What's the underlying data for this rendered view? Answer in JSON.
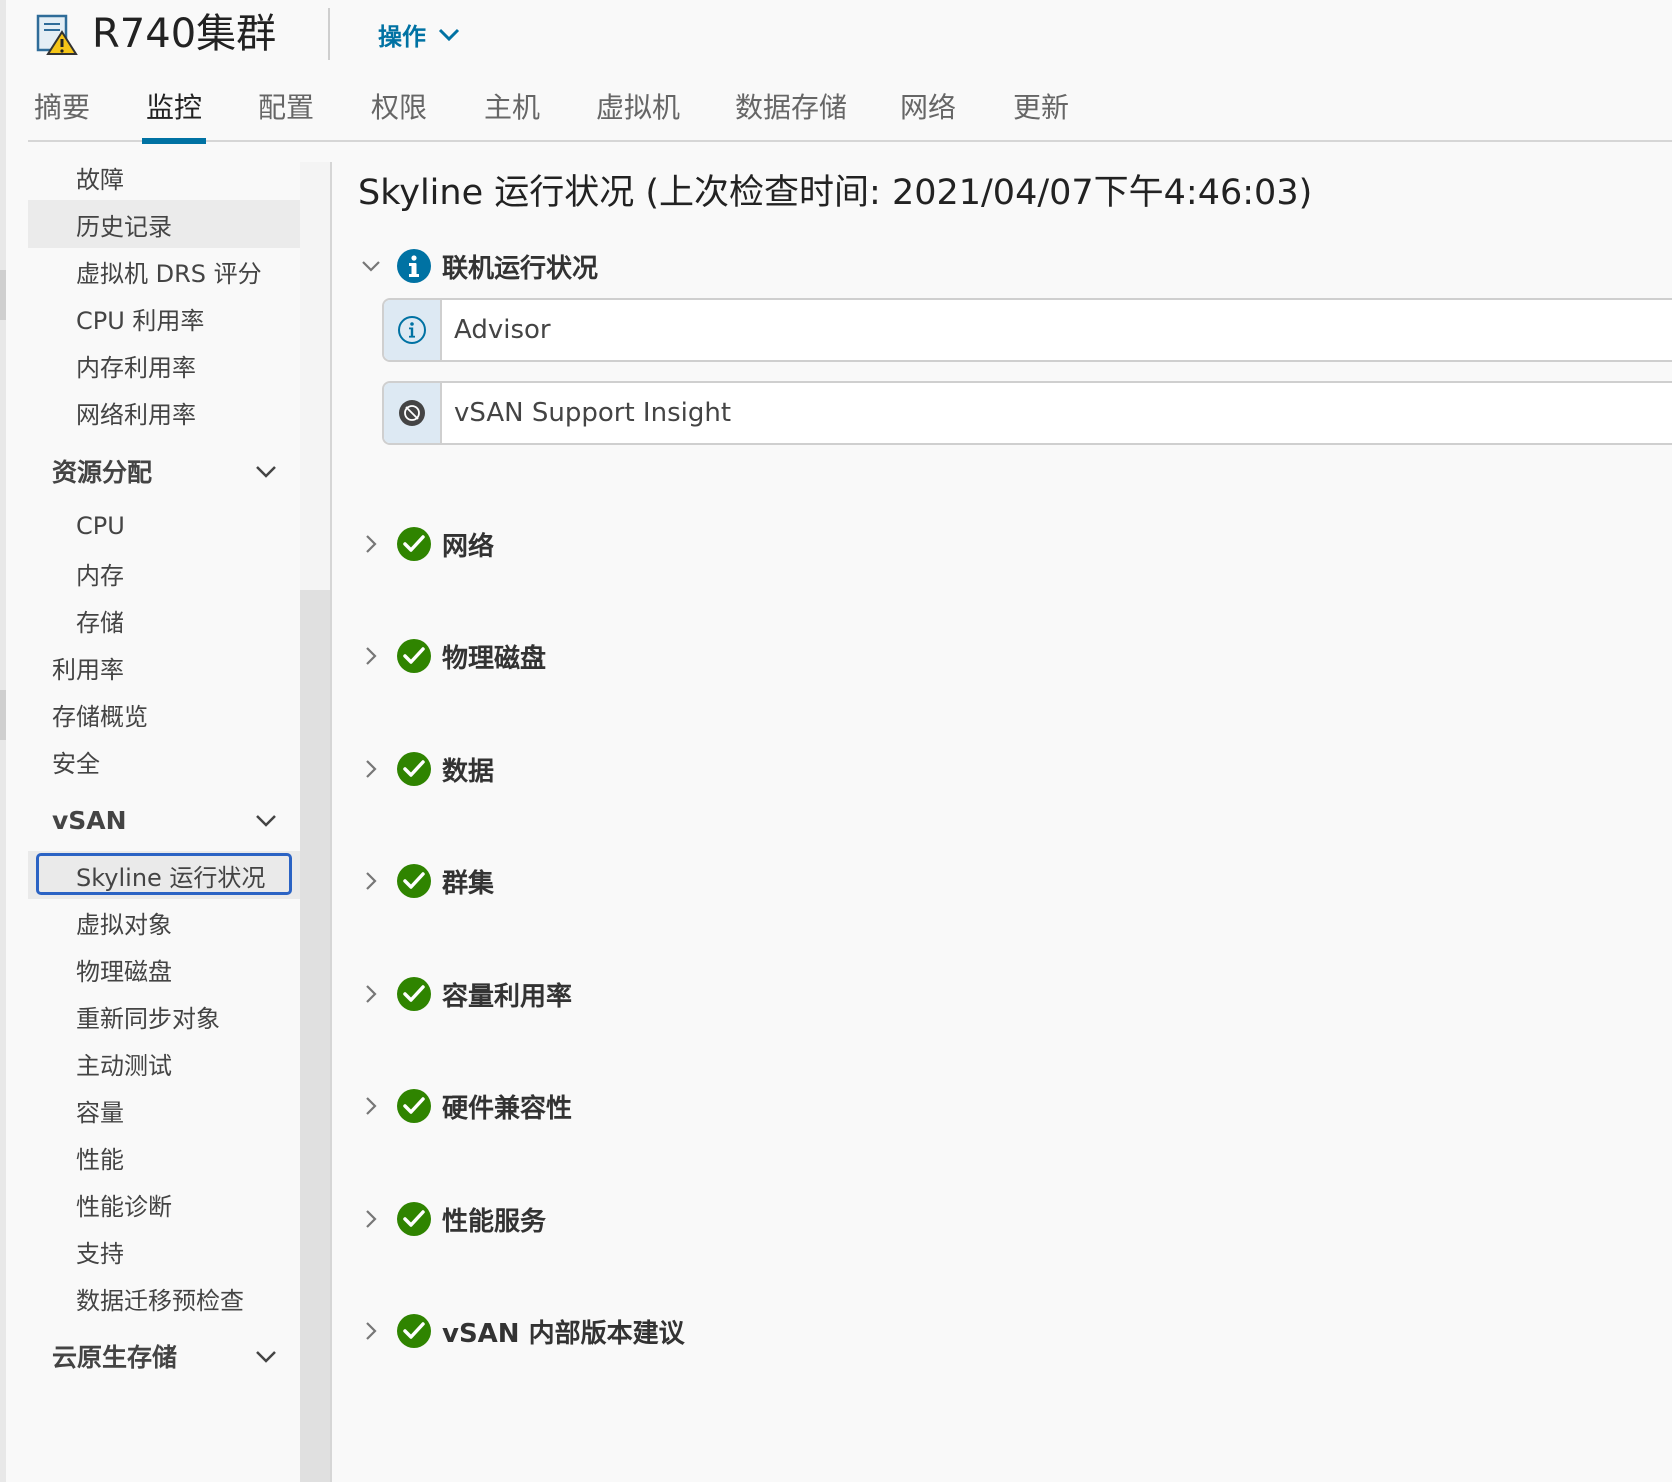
{
  "header": {
    "title": "R740集群",
    "actions_label": "操作"
  },
  "tabs": [
    "摘要",
    "监控",
    "配置",
    "权限",
    "主机",
    "虚拟机",
    "数据存储",
    "网络",
    "更新"
  ],
  "active_tab": "监控",
  "nav": {
    "items_top": [
      "故障",
      "历史记录",
      "虚拟机 DRS 评分",
      "CPU 利用率",
      "内存利用率",
      "网络利用率"
    ],
    "group_resource": "资源分配",
    "resource_items": [
      "CPU",
      "内存",
      "存储"
    ],
    "plain_items": [
      "利用率",
      "存储概览",
      "安全"
    ],
    "group_vsan": "vSAN",
    "vsan_items": [
      "Skyline 运行状况",
      "虚拟对象",
      "物理磁盘",
      "重新同步对象",
      "主动测试",
      "容量",
      "性能",
      "性能诊断",
      "支持",
      "数据迁移预检查"
    ],
    "group_cloud": "云原生存储",
    "selected_item": "Skyline 运行状况"
  },
  "main": {
    "title": "Skyline 运行状况 (上次检查时间: 2021/04/07下午4:46:03)",
    "online_section": {
      "label": "联机运行状况",
      "status": "info",
      "expanded": true,
      "cards": [
        {
          "label": "Advisor",
          "icon": "info-icon"
        },
        {
          "label": "vSAN Support Insight",
          "icon": "disabled-icon"
        }
      ]
    },
    "sections": [
      {
        "label": "网络",
        "status": "ok"
      },
      {
        "label": "物理磁盘",
        "status": "ok"
      },
      {
        "label": "数据",
        "status": "ok"
      },
      {
        "label": "群集",
        "status": "ok"
      },
      {
        "label": "容量利用率",
        "status": "ok"
      },
      {
        "label": "硬件兼容性",
        "status": "ok"
      },
      {
        "label": "性能服务",
        "status": "ok"
      },
      {
        "label": "vSAN 内部版本建议",
        "status": "ok"
      }
    ]
  },
  "colors": {
    "accent": "#0072a3",
    "ok": "#2f8400",
    "info": "#0072a3",
    "selection_border": "#2b63c4"
  }
}
